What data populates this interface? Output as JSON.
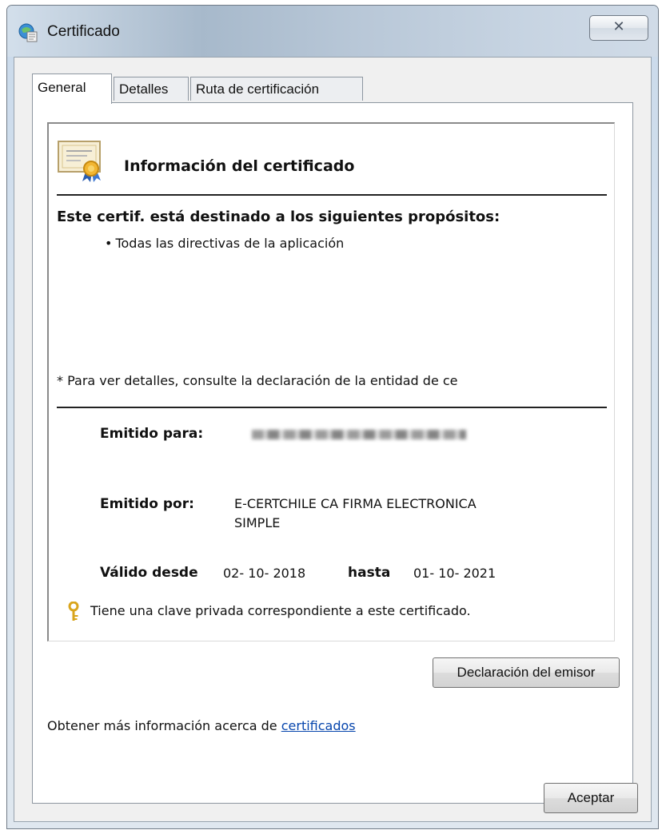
{
  "window": {
    "title": "Certificado",
    "close_glyph": "✕",
    "icons": [
      "certificate-window-icon",
      "close-icon"
    ]
  },
  "tabs": [
    {
      "label": "General",
      "active": true
    },
    {
      "label": "Detalles",
      "active": false
    },
    {
      "label": "Ruta de certificación",
      "active": false
    }
  ],
  "info": {
    "title": "Información del certificado",
    "purpose_heading": "Este certif. está destinado a los siguientes propósitos:",
    "purpose_bullet": "•",
    "purpose_item": "Todas las directivas de la aplicación",
    "note": "* Para ver detalles, consulte la declaración de la entidad de ce",
    "issued_to_label": "Emitido para:",
    "issued_by_label": "Emitido por:",
    "issued_by_value_line1": "E-CERTCHILE CA FIRMA ELECTRONICA",
    "issued_by_value_line2": "SIMPLE",
    "valid_from_label": "Válido desde",
    "valid_from_value": "02- 10- 2018",
    "valid_to_label": "hasta",
    "valid_to_value": "01- 10- 2021",
    "private_key_text": "Tiene una clave privada correspondiente a este certificado."
  },
  "buttons": {
    "issuer_statement": "Declaración del emisor",
    "ok": "Aceptar"
  },
  "more_info": {
    "text": "Obtener más información acerca de ",
    "link": "certificados"
  },
  "colors": {
    "link": "#0645ad",
    "key": "#d9a51c",
    "ribbon": "#2a5db0"
  }
}
